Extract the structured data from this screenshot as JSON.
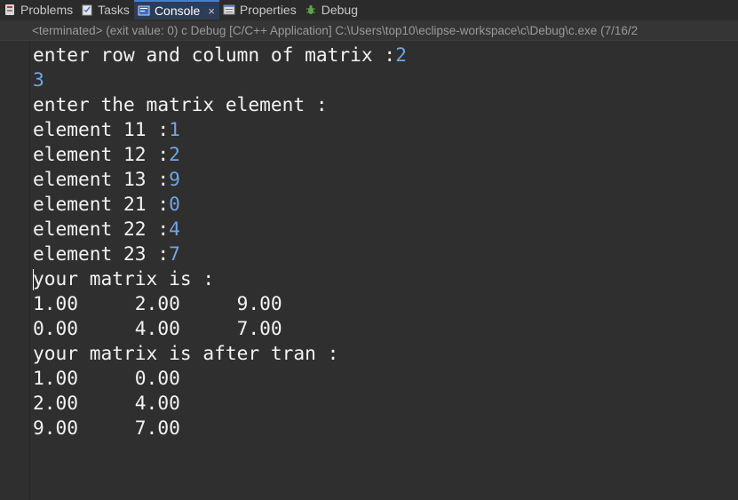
{
  "tabs": [
    {
      "label": "Problems",
      "icon": "problems-icon",
      "active": false
    },
    {
      "label": "Tasks",
      "icon": "tasks-icon",
      "active": false
    },
    {
      "label": "Console",
      "icon": "console-icon",
      "active": true
    },
    {
      "label": "Properties",
      "icon": "properties-icon",
      "active": false
    },
    {
      "label": "Debug",
      "icon": "debug-icon",
      "active": false
    }
  ],
  "close_glyph": "×",
  "status": "<terminated> (exit value: 0) c Debug [C/C++ Application] C:\\Users\\top10\\eclipse-workspace\\c\\Debug\\c.exe (7/16/2",
  "console": {
    "lines": [
      {
        "out": "enter row and column of matrix :",
        "in": "2"
      },
      {
        "out": "",
        "in": "3"
      },
      {
        "out": "enter the matrix element :",
        "in": ""
      },
      {
        "out": "element 11 :",
        "in": "1"
      },
      {
        "out": "element 12 :",
        "in": "2"
      },
      {
        "out": "element 13 :",
        "in": "9"
      },
      {
        "out": "element 21 :",
        "in": "0"
      },
      {
        "out": "element 22 :",
        "in": "4"
      },
      {
        "out": "element 23 :",
        "in": "7"
      },
      {
        "out": "your matrix is :",
        "in": ""
      },
      {
        "out": "1.00     2.00     9.00",
        "in": ""
      },
      {
        "out": "0.00     4.00     7.00",
        "in": ""
      },
      {
        "out": "your matrix is after tran :",
        "in": ""
      },
      {
        "out": "1.00     0.00",
        "in": ""
      },
      {
        "out": "2.00     4.00",
        "in": ""
      },
      {
        "out": "9.00     7.00",
        "in": ""
      }
    ]
  },
  "colors": {
    "active_tab": "#2d3c57",
    "input_text": "#6fa6e0",
    "output_text": "#f2f2f2"
  }
}
